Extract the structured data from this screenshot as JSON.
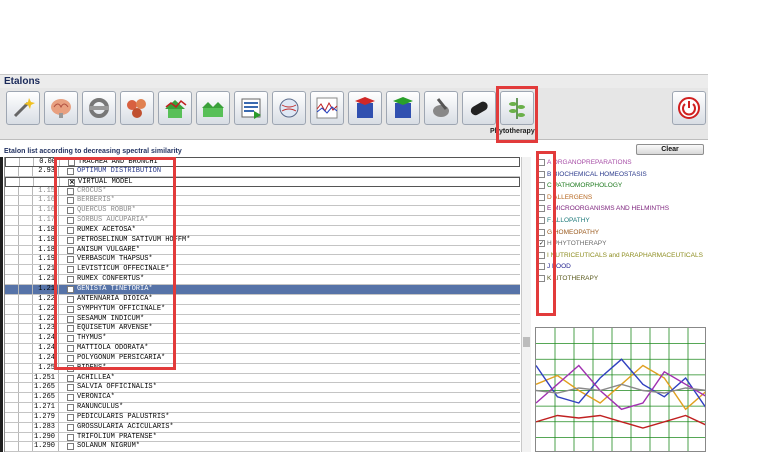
{
  "window": {
    "title": "Etalons"
  },
  "toolbar": {
    "caption": "Phytotherapy",
    "icons": [
      "wand-icon",
      "brain-icon",
      "pipes-icon",
      "cells-icon",
      "house-graph-icon",
      "houses-icon",
      "list-icon",
      "globe-icon",
      "wave-graph-icon",
      "magnet-red-icon",
      "magnet-green-icon",
      "mortar-icon",
      "capsule-icon",
      "herb-icon",
      "power-icon"
    ]
  },
  "etalon_list": {
    "title": "Etalon list according to decreasing spectral similarity",
    "clear_label": "Clear",
    "rows": [
      {
        "value": "0.00",
        "name": "TRACHEA AND BRONCHI",
        "style": "framed",
        "checked": false
      },
      {
        "value": "2.93",
        "name": "OPTIMUM DISTRIBUTION",
        "style": "blue",
        "checked": false
      },
      {
        "value": "",
        "name": "VIRTUAL MODEL",
        "style": "framed",
        "checked": true
      },
      {
        "value": "1.15",
        "name": "CROCUS*",
        "style": "gray",
        "checked": false
      },
      {
        "value": "1.16",
        "name": "BERBERIS*",
        "style": "gray",
        "checked": false
      },
      {
        "value": "1.16",
        "name": "QUERCUS ROBUR*",
        "style": "gray",
        "checked": false
      },
      {
        "value": "1.17",
        "name": "SORBUS AUCUPARIA*",
        "style": "gray",
        "checked": false
      },
      {
        "value": "1.18",
        "name": "RUMEX ACETOSA*",
        "style": "",
        "checked": false
      },
      {
        "value": "1.18",
        "name": "PETROSELINUM SATIVUM HOFFM*",
        "style": "",
        "checked": false
      },
      {
        "value": "1.18",
        "name": "ANISUM VULGARE*",
        "style": "",
        "checked": false
      },
      {
        "value": "1.19",
        "name": "VERBASCUM THAPSUS*",
        "style": "",
        "checked": false
      },
      {
        "value": "1.21",
        "name": "LEVISTICUM OFFECINALE*",
        "style": "",
        "checked": false
      },
      {
        "value": "1.21",
        "name": "RUMEX CONFERTUS*",
        "style": "",
        "checked": false
      },
      {
        "value": "1.21",
        "name": "GENISTA TINETORIA*",
        "style": "sel",
        "checked": false
      },
      {
        "value": "1.22",
        "name": "ANTENNARIA DIOICA*",
        "style": "",
        "checked": false
      },
      {
        "value": "1.22",
        "name": "SYMPHYTUM OFFICINALE*",
        "style": "",
        "checked": false
      },
      {
        "value": "1.22",
        "name": "SESAMUM INDICUM*",
        "style": "",
        "checked": false
      },
      {
        "value": "1.23",
        "name": "EQUISETUM ARVENSE*",
        "style": "",
        "checked": false
      },
      {
        "value": "1.24",
        "name": "THYMUS*",
        "style": "",
        "checked": false
      },
      {
        "value": "1.24",
        "name": "MATTIOLA ODORATA*",
        "style": "",
        "checked": false
      },
      {
        "value": "1.24",
        "name": "POLYGONUM PERSICARIA*",
        "style": "",
        "checked": false
      },
      {
        "value": "1.25",
        "name": "BIDENS*",
        "style": "",
        "checked": false
      },
      {
        "value": "1.251",
        "name": "ACHILLEA*",
        "style": "",
        "checked": false
      },
      {
        "value": "1.265",
        "name": "SALVIA OFFICINALIS*",
        "style": "",
        "checked": false
      },
      {
        "value": "1.265",
        "name": "VERONICA*",
        "style": "",
        "checked": false
      },
      {
        "value": "1.271",
        "name": "RANUNCULUS*",
        "style": "",
        "checked": false
      },
      {
        "value": "1.279",
        "name": "PEDICULARIS PALUSTRIS*",
        "style": "",
        "checked": false
      },
      {
        "value": "1.283",
        "name": "GROSSULARIA ACICULARIS*",
        "style": "",
        "checked": false
      },
      {
        "value": "1.290",
        "name": "TRIFOLIUM PRATENSE*",
        "style": "",
        "checked": false
      },
      {
        "value": "1.290",
        "name": "SOLANUM NIGRUM*",
        "style": "",
        "checked": false
      }
    ]
  },
  "categories": [
    {
      "label": "A ORGANOPREPARATIONS",
      "color": "#a64ca6",
      "checked": false
    },
    {
      "label": "B BIOCHEMICAL HOMEOSTASIS",
      "color": "#2b3a8c",
      "checked": false
    },
    {
      "label": "C PATHOMORPHOLOGY",
      "color": "#1e7a1e",
      "checked": false
    },
    {
      "label": "D ALLERGENS",
      "color": "#b5651d",
      "checked": false
    },
    {
      "label": "E MICROORGANISMS AND HELMINTHS",
      "color": "#7a1e7a",
      "checked": false
    },
    {
      "label": "F ALLOPATHY",
      "color": "#1e7a7a",
      "checked": false
    },
    {
      "label": "G HOMEOPATHY",
      "color": "#9a5a1e",
      "checked": false
    },
    {
      "label": "H PHYTOTHERAPY",
      "color": "#6b6b6b",
      "checked": true
    },
    {
      "label": "I NUTRICEUTICALS and PARAPHARMACEUTICALS",
      "color": "#8c8c1e",
      "checked": false
    },
    {
      "label": "J FOOD",
      "color": "#1e1e8c",
      "checked": false
    },
    {
      "label": "K LITOTHERAPY",
      "color": "#5a5a1e",
      "checked": false
    }
  ],
  "spectrum_chart": {
    "grid_bg": "#ffffff",
    "grid_color": "#1e8a1e",
    "series": [
      {
        "color": "#e0a020",
        "values": [
          0.55,
          0.62,
          0.5,
          0.4,
          0.55,
          0.7,
          0.6,
          0.35,
          0.5
        ]
      },
      {
        "color": "#3040c0",
        "values": [
          0.7,
          0.45,
          0.4,
          0.6,
          0.75,
          0.55,
          0.45,
          0.6,
          0.35
        ]
      },
      {
        "color": "#a030b0",
        "values": [
          0.4,
          0.55,
          0.7,
          0.5,
          0.35,
          0.4,
          0.65,
          0.55,
          0.45
        ]
      },
      {
        "color": "#c02020",
        "values": [
          0.25,
          0.3,
          0.28,
          0.3,
          0.25,
          0.2,
          0.25,
          0.3,
          0.22
        ]
      },
      {
        "color": "#8a8a8a",
        "values": [
          0.5,
          0.48,
          0.52,
          0.5,
          0.55,
          0.5,
          0.48,
          0.52,
          0.5
        ]
      }
    ]
  }
}
